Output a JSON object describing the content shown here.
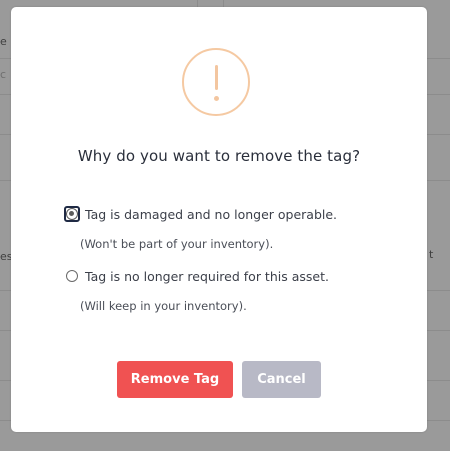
{
  "background": {
    "fragments": [
      "e l",
      "c",
      "es",
      "t"
    ]
  },
  "dialog": {
    "icon": "warning-exclamation-icon",
    "icon_color": "#f5c9a2",
    "question": "Why do you want to remove the tag?",
    "options": [
      {
        "label": "Tag is damaged and no longer operable.",
        "note": "(Won't be part of your inventory).",
        "checked": true
      },
      {
        "label": "Tag is no longer required for this asset.",
        "note": "(Will keep in your inventory).",
        "checked": false
      }
    ],
    "buttons": {
      "remove_label": "Remove Tag",
      "remove_color": "#f05252",
      "cancel_label": "Cancel",
      "cancel_color": "#b8b9c6"
    }
  }
}
